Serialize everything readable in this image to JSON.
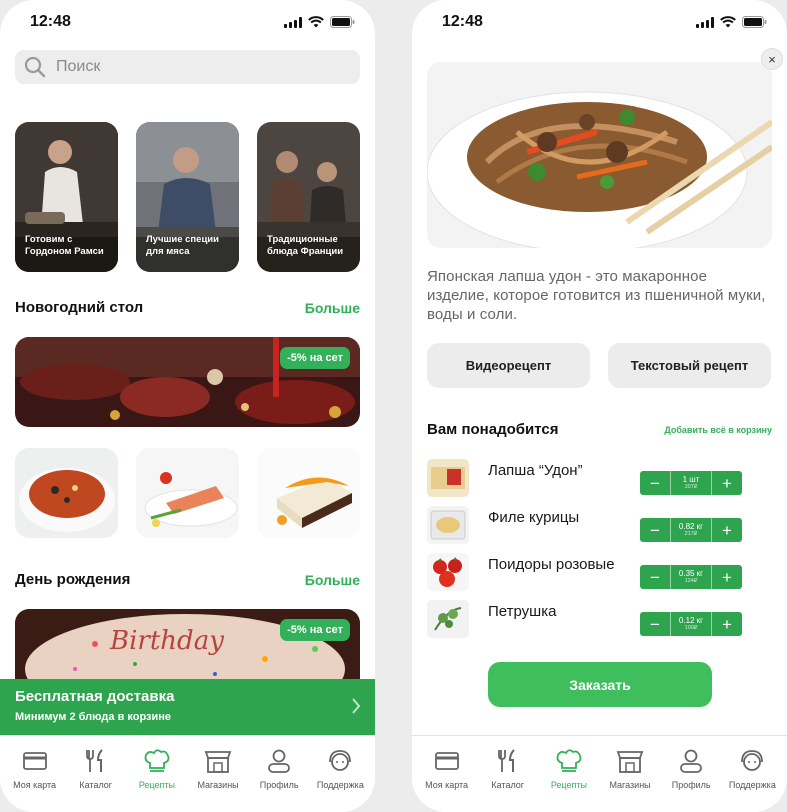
{
  "status": {
    "time": "12:48"
  },
  "left": {
    "search": {
      "placeholder": "Поиск"
    },
    "stories": [
      {
        "label": "Готовим с Гордоном Рамси"
      },
      {
        "label": "Лучшие специи для мяса"
      },
      {
        "label": "Традиционные блюда Франции"
      }
    ],
    "sections": [
      {
        "title": "Новогодний стол",
        "more": "Больше",
        "badge": "-5% на сет"
      },
      {
        "title": "День рождения",
        "more": "Больше",
        "badge": "-5% на сет"
      }
    ],
    "promo": {
      "title": "Бесплатная доставка",
      "subtitle": "Минимум 2 блюда в корзине"
    }
  },
  "right": {
    "close_label": "×",
    "description": "Японская лапша удон - это макаронное изделие, которое готовится из пшеничной муки, воды и соли.",
    "buttons": {
      "video": "Видеорецепт",
      "text": "Текстовый рецепт"
    },
    "need": {
      "title": "Вам понадобится",
      "add_all": "Добавить всё в корзину"
    },
    "ingredients": [
      {
        "name": "Лапша “Удон”",
        "qty": "1 шт",
        "price": "307₽"
      },
      {
        "name": "Филе курицы",
        "qty": "0.82 кг",
        "price": "217₽"
      },
      {
        "name": "Поидоры розовые",
        "qty": "0.35 кг",
        "price": "124₽"
      },
      {
        "name": "Петрушка",
        "qty": "0.12 кг",
        "price": "100₽"
      }
    ],
    "order_label": "Заказать"
  },
  "tabbar": [
    {
      "label": "Моя карта",
      "icon": "card-icon"
    },
    {
      "label": "Каталог",
      "icon": "cutlery-icon"
    },
    {
      "label": "Рецепты",
      "icon": "chef-hat-icon",
      "active": true
    },
    {
      "label": "Магазины",
      "icon": "store-icon"
    },
    {
      "label": "Профиль",
      "icon": "profile-icon"
    },
    {
      "label": "Поддержка",
      "icon": "support-icon"
    }
  ],
  "colors": {
    "accent": "#33b05a",
    "promo": "#2ea44f",
    "inactive": "#555555"
  }
}
